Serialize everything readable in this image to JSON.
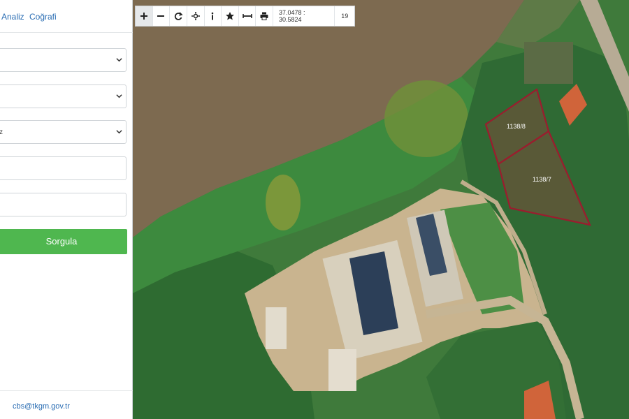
{
  "tabs": [
    {
      "label": "Analiz"
    },
    {
      "label": "Coğrafi"
    }
  ],
  "form": {
    "select1_value": "",
    "select2_value": "",
    "select3_value": "z",
    "input1_value": "",
    "input2_value": "",
    "submit_label": "Sorgula"
  },
  "footer": {
    "email": "cbs@tkgm.gov.tr"
  },
  "toolbar": {
    "icons": [
      "zoom-in-icon",
      "zoom-out-icon",
      "refresh-icon",
      "pan-icon",
      "info-icon",
      "favorite-icon",
      "measure-icon",
      "print-icon"
    ],
    "coordinates": "37.0478 : 30.5824",
    "zoom_level": "19"
  },
  "parcels": [
    {
      "label": "1138/8"
    },
    {
      "label": "1138/7"
    }
  ],
  "colors": {
    "accent": "#2a6db3",
    "button": "#4fb74f",
    "parcel_outline": "#9b1c2e"
  }
}
